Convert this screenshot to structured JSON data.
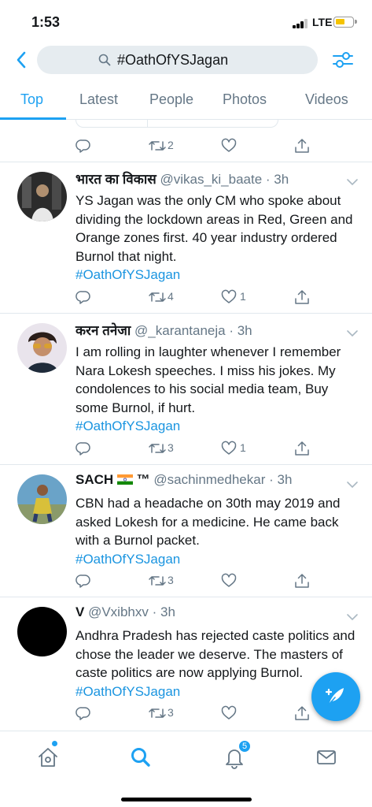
{
  "status_bar": {
    "time": "1:53",
    "network": "LTE",
    "battery_level": 0.55,
    "battery_color": "#f5c300"
  },
  "search": {
    "query": "#OathOfYSJagan"
  },
  "tabs": [
    {
      "label": "Top",
      "active": true
    },
    {
      "label": "Latest",
      "active": false
    },
    {
      "label": "People",
      "active": false
    },
    {
      "label": "Photos",
      "active": false
    },
    {
      "label": "Videos",
      "active": false
    }
  ],
  "partial_tweet": {
    "retweets": "2",
    "likes": ""
  },
  "tweets": [
    {
      "name": "भारत का विकास",
      "handle": "@vikas_ki_baate",
      "time": "· 3h",
      "text": "YS Jagan was the only CM who spoke about dividing the lockdown areas in Red, Green and Orange zones first. 40 year industry ordered Burnol that night.",
      "hashtag": "#OathOfYSJagan",
      "replies": "",
      "retweets": "4",
      "likes": "1"
    },
    {
      "name": "करन तनेजा",
      "handle": "@_karantaneja",
      "time": "· 3h",
      "text": "I am rolling in laughter whenever I remember Nara Lokesh speeches. I miss his jokes. My condolences to his social media team, Buy some Burnol, if hurt.",
      "hashtag": "#OathOfYSJagan",
      "replies": "",
      "retweets": "3",
      "likes": "1"
    },
    {
      "name": "SACH",
      "name_suffix": "™",
      "handle": "@sachinmedhekar",
      "time": "· 3h",
      "text": "CBN had a headache on 30th may 2019 and asked Lokesh for a medicine. He came back with a Burnol packet.",
      "hashtag": "#OathOfYSJagan",
      "replies": "",
      "retweets": "3",
      "likes": ""
    },
    {
      "name": "V",
      "handle": "@Vxibhxv",
      "time": "· 3h",
      "text": "Andhra Pradesh has rejected caste politics and chose the leader we deserve. The masters of caste politics are now applying Burnol.",
      "hashtag": "#OathOfYSJagan",
      "replies": "",
      "retweets": "3",
      "likes": ""
    }
  ],
  "bottom_nav": {
    "notifications_count": "5"
  },
  "colors": {
    "accent": "#1da1f2",
    "hashtag": "#1b95e0",
    "secondary_text": "#657786",
    "divider": "#e1e8ed"
  }
}
